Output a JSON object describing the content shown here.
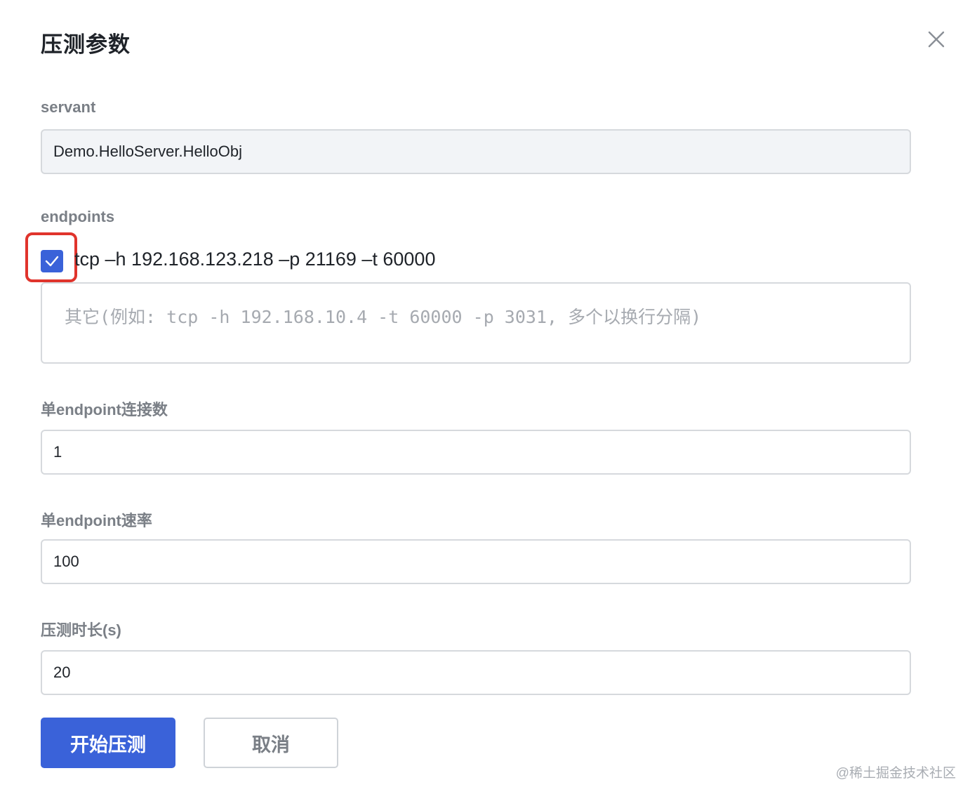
{
  "dialog": {
    "title": "压测参数"
  },
  "servant": {
    "label": "servant",
    "value": "Demo.HelloServer.HelloObj"
  },
  "endpoints": {
    "label": "endpoints",
    "items": [
      {
        "checked": true,
        "text": "tcp –h 192.168.123.218 –p 21169 –t 60000"
      }
    ],
    "other_placeholder": "其它(例如: tcp -h 192.168.10.4 -t 60000 -p 3031, 多个以换行分隔)",
    "other_value": ""
  },
  "connections": {
    "label": "单endpoint连接数",
    "value": "1"
  },
  "rate": {
    "label": "单endpoint速率",
    "value": "100"
  },
  "duration": {
    "label": "压测时长(s)",
    "value": "20"
  },
  "actions": {
    "start_label": "开始压测",
    "cancel_label": "取消"
  },
  "watermark": "@稀土掘金技术社区",
  "colors": {
    "primary": "#3a62d9",
    "highlight": "#e0342c",
    "label": "#7a7f86",
    "border": "#d6d9dd"
  }
}
